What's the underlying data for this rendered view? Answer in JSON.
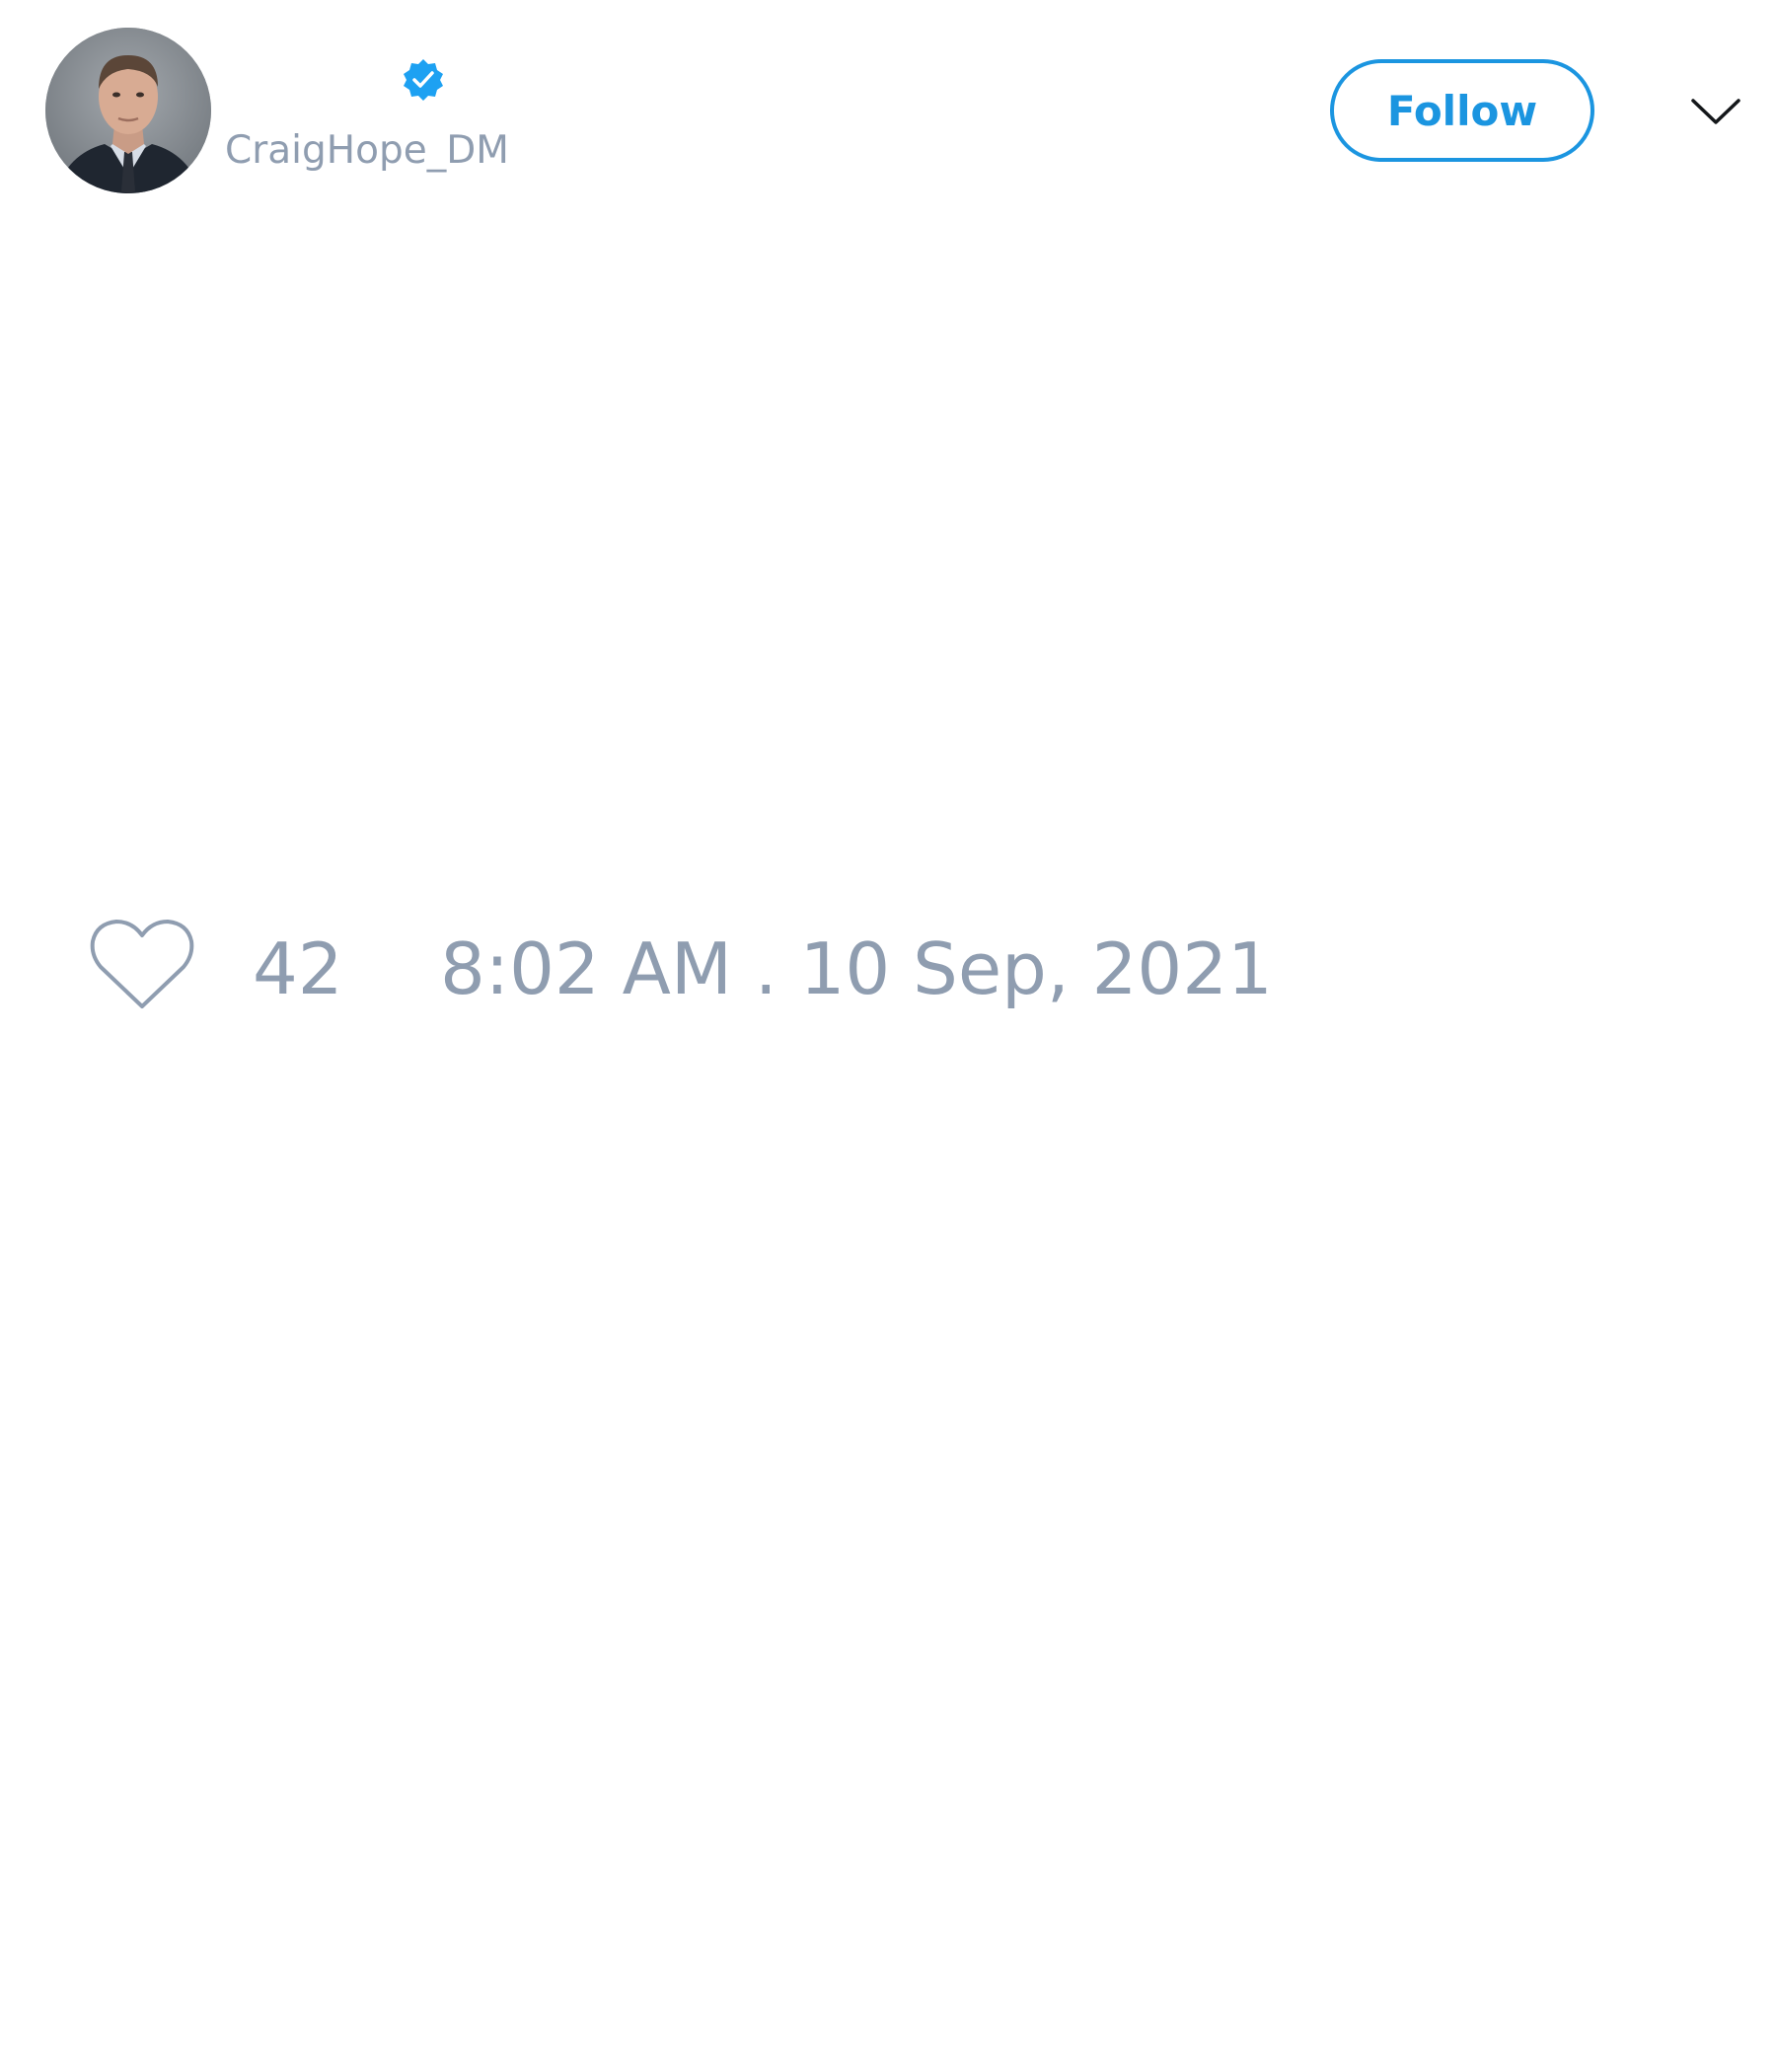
{
  "tweet": {
    "author": {
      "handle": "CraigHope_DM",
      "verified": true,
      "avatar": "profile-photo"
    },
    "follow_label": "Follow",
    "menu_icon": "chevron-down-icon",
    "like_icon": "heart-icon",
    "likes": "42",
    "timestamp": "8:02 AM . 10 Sep, 2021"
  },
  "colors": {
    "accent": "#1b95e0",
    "muted_text": "#8f9db0",
    "background": "#ffffff"
  }
}
